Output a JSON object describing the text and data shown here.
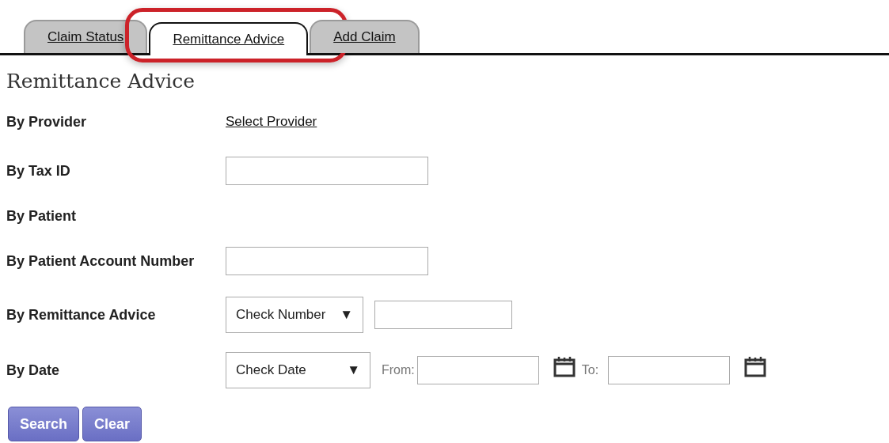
{
  "tabs": [
    {
      "label": "Claim Status",
      "selected": false,
      "highlighted": false
    },
    {
      "label": "Remittance Advice",
      "selected": true,
      "highlighted": true
    },
    {
      "label": "Add Claim",
      "selected": false,
      "highlighted": false
    }
  ],
  "heading": "Remittance Advice",
  "rows": [
    {
      "kind": "link",
      "label": "By Provider",
      "link": "Select Provider"
    },
    {
      "kind": "input",
      "label": "By Tax ID"
    },
    {
      "kind": "none",
      "label": "By Patient"
    },
    {
      "kind": "input",
      "label": "By Patient Account Number"
    },
    {
      "kind": "select-input",
      "label": "By Remittance Advice",
      "select": "Check Number",
      "arrow": "▼"
    },
    {
      "kind": "date-range",
      "label": "By Date",
      "select": "Check Date",
      "arrow": "▼",
      "from": "From:",
      "to": "To:"
    }
  ],
  "buttons": [
    "Search",
    "Clear"
  ]
}
